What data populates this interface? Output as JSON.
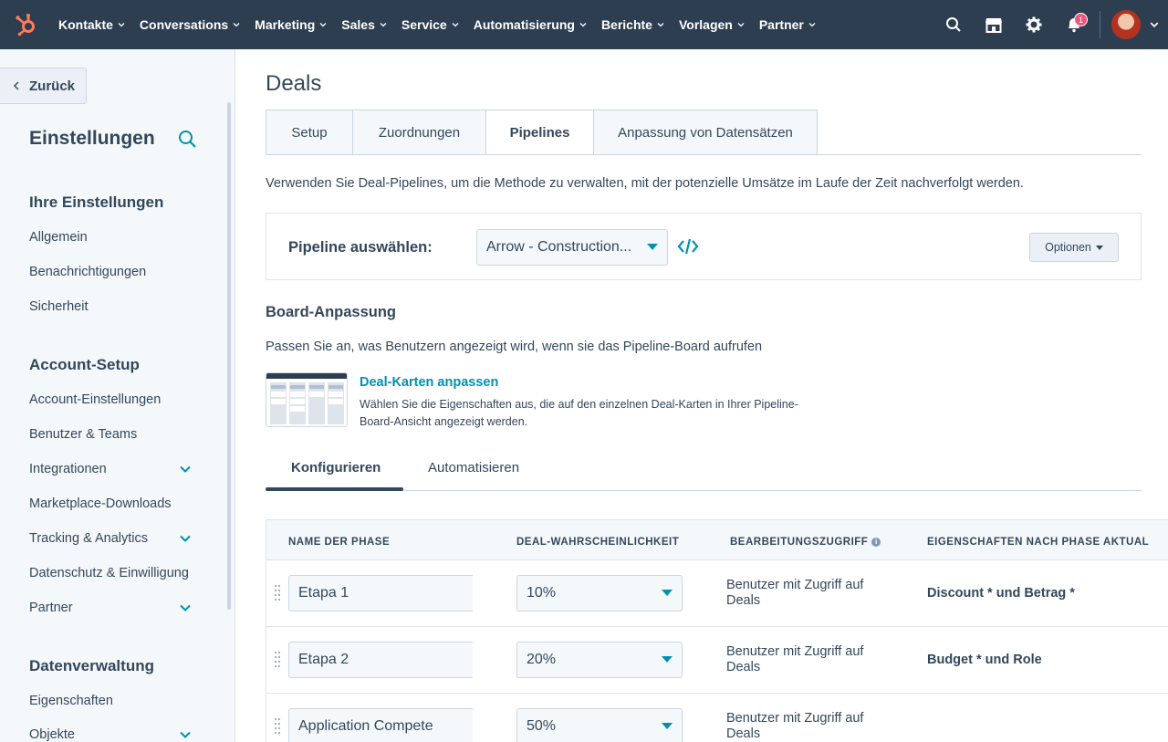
{
  "topnav": {
    "items": [
      "Kontakte",
      "Conversations",
      "Marketing",
      "Sales",
      "Service",
      "Automatisierung",
      "Berichte",
      "Vorlagen",
      "Partner"
    ],
    "notification_count": "1",
    "colors": {
      "bg": "#2d3e50",
      "logo": "#ff7a59",
      "badge": "#f2547d"
    }
  },
  "sidebar": {
    "back_label": "Zurück",
    "title": "Einstellungen",
    "sections": [
      {
        "title": "Ihre Einstellungen",
        "items": [
          "Allgemein",
          "Benachrichtigungen",
          "Sicherheit"
        ]
      },
      {
        "title": "Account-Setup",
        "items": [
          "Account-Einstellungen",
          "Benutzer & Teams",
          "Integrationen",
          "Marketplace-Downloads",
          "Tracking & Analytics",
          "Datenschutz & Einwilligung",
          "Partner"
        ]
      },
      {
        "title": "Datenverwaltung",
        "items": [
          "Eigenschaften",
          "Objekte"
        ]
      }
    ]
  },
  "main": {
    "title": "Deals",
    "tabs": [
      "Setup",
      "Zuordnungen",
      "Pipelines",
      "Anpassung von Datensätzen"
    ],
    "active_tab": "Pipelines",
    "description": "Verwenden Sie Deal-Pipelines, um die Methode zu verwalten, mit der potenzielle Umsätze im Laufe der Zeit nachverfolgt werden.",
    "pipeline": {
      "label": "Pipeline auswählen:",
      "selected": "Arrow - Construction...",
      "options_button": "Optionen"
    },
    "board": {
      "title": "Board-Anpassung",
      "description": "Passen Sie an, was Benutzern angezeigt wird, wenn sie das Pipeline-Board aufrufen",
      "link": "Deal-Karten anpassen",
      "link_desc": "Wählen Sie die Eigenschaften aus, die auf den einzelnen Deal-Karten in Ihrer Pipeline-Board-Ansicht angezeigt werden."
    },
    "subtabs": [
      "Konfigurieren",
      "Automatisieren"
    ],
    "active_subtab": "Konfigurieren",
    "table": {
      "headers": [
        "NAME DER PHASE",
        "DEAL-WAHRSCHEINLICHKEIT",
        "BEARBEITUNGSZUGRIFF",
        "EIGENSCHAFTEN NACH PHASE AKTUAL"
      ],
      "rows": [
        {
          "name": "Etapa 1",
          "probability": "10%",
          "access": "Benutzer mit Zugriff auf Deals",
          "props": "Discount * und Betrag *"
        },
        {
          "name": "Etapa 2",
          "probability": "20%",
          "access": "Benutzer mit Zugriff auf Deals",
          "props": "Budget * und Role"
        },
        {
          "name": "Application Compete",
          "probability": "50%",
          "access": "Benutzer mit Zugriff auf Deals",
          "props": ""
        }
      ]
    },
    "accent_color": "#0091ae"
  }
}
